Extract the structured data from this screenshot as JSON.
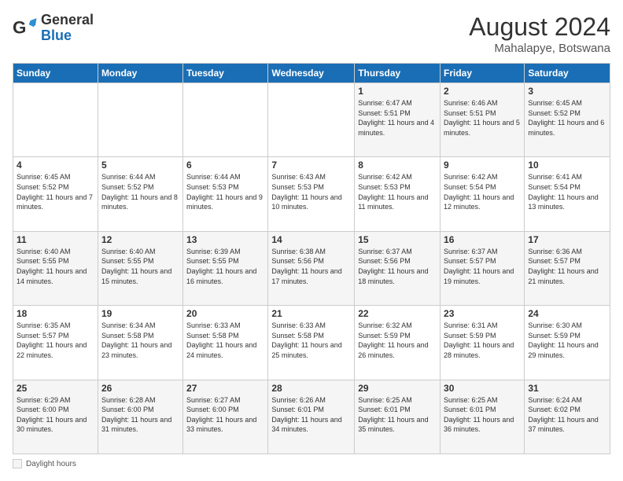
{
  "header": {
    "logo_general": "General",
    "logo_blue": "Blue",
    "month_year": "August 2024",
    "location": "Mahalapye, Botswana"
  },
  "days_of_week": [
    "Sunday",
    "Monday",
    "Tuesday",
    "Wednesday",
    "Thursday",
    "Friday",
    "Saturday"
  ],
  "weeks": [
    [
      {
        "day": "",
        "info": ""
      },
      {
        "day": "",
        "info": ""
      },
      {
        "day": "",
        "info": ""
      },
      {
        "day": "",
        "info": ""
      },
      {
        "day": "1",
        "info": "Sunrise: 6:47 AM\nSunset: 5:51 PM\nDaylight: 11 hours and 4 minutes."
      },
      {
        "day": "2",
        "info": "Sunrise: 6:46 AM\nSunset: 5:51 PM\nDaylight: 11 hours and 5 minutes."
      },
      {
        "day": "3",
        "info": "Sunrise: 6:45 AM\nSunset: 5:52 PM\nDaylight: 11 hours and 6 minutes."
      }
    ],
    [
      {
        "day": "4",
        "info": "Sunrise: 6:45 AM\nSunset: 5:52 PM\nDaylight: 11 hours and 7 minutes."
      },
      {
        "day": "5",
        "info": "Sunrise: 6:44 AM\nSunset: 5:52 PM\nDaylight: 11 hours and 8 minutes."
      },
      {
        "day": "6",
        "info": "Sunrise: 6:44 AM\nSunset: 5:53 PM\nDaylight: 11 hours and 9 minutes."
      },
      {
        "day": "7",
        "info": "Sunrise: 6:43 AM\nSunset: 5:53 PM\nDaylight: 11 hours and 10 minutes."
      },
      {
        "day": "8",
        "info": "Sunrise: 6:42 AM\nSunset: 5:53 PM\nDaylight: 11 hours and 11 minutes."
      },
      {
        "day": "9",
        "info": "Sunrise: 6:42 AM\nSunset: 5:54 PM\nDaylight: 11 hours and 12 minutes."
      },
      {
        "day": "10",
        "info": "Sunrise: 6:41 AM\nSunset: 5:54 PM\nDaylight: 11 hours and 13 minutes."
      }
    ],
    [
      {
        "day": "11",
        "info": "Sunrise: 6:40 AM\nSunset: 5:55 PM\nDaylight: 11 hours and 14 minutes."
      },
      {
        "day": "12",
        "info": "Sunrise: 6:40 AM\nSunset: 5:55 PM\nDaylight: 11 hours and 15 minutes."
      },
      {
        "day": "13",
        "info": "Sunrise: 6:39 AM\nSunset: 5:55 PM\nDaylight: 11 hours and 16 minutes."
      },
      {
        "day": "14",
        "info": "Sunrise: 6:38 AM\nSunset: 5:56 PM\nDaylight: 11 hours and 17 minutes."
      },
      {
        "day": "15",
        "info": "Sunrise: 6:37 AM\nSunset: 5:56 PM\nDaylight: 11 hours and 18 minutes."
      },
      {
        "day": "16",
        "info": "Sunrise: 6:37 AM\nSunset: 5:57 PM\nDaylight: 11 hours and 19 minutes."
      },
      {
        "day": "17",
        "info": "Sunrise: 6:36 AM\nSunset: 5:57 PM\nDaylight: 11 hours and 21 minutes."
      }
    ],
    [
      {
        "day": "18",
        "info": "Sunrise: 6:35 AM\nSunset: 5:57 PM\nDaylight: 11 hours and 22 minutes."
      },
      {
        "day": "19",
        "info": "Sunrise: 6:34 AM\nSunset: 5:58 PM\nDaylight: 11 hours and 23 minutes."
      },
      {
        "day": "20",
        "info": "Sunrise: 6:33 AM\nSunset: 5:58 PM\nDaylight: 11 hours and 24 minutes."
      },
      {
        "day": "21",
        "info": "Sunrise: 6:33 AM\nSunset: 5:58 PM\nDaylight: 11 hours and 25 minutes."
      },
      {
        "day": "22",
        "info": "Sunrise: 6:32 AM\nSunset: 5:59 PM\nDaylight: 11 hours and 26 minutes."
      },
      {
        "day": "23",
        "info": "Sunrise: 6:31 AM\nSunset: 5:59 PM\nDaylight: 11 hours and 28 minutes."
      },
      {
        "day": "24",
        "info": "Sunrise: 6:30 AM\nSunset: 5:59 PM\nDaylight: 11 hours and 29 minutes."
      }
    ],
    [
      {
        "day": "25",
        "info": "Sunrise: 6:29 AM\nSunset: 6:00 PM\nDaylight: 11 hours and 30 minutes."
      },
      {
        "day": "26",
        "info": "Sunrise: 6:28 AM\nSunset: 6:00 PM\nDaylight: 11 hours and 31 minutes."
      },
      {
        "day": "27",
        "info": "Sunrise: 6:27 AM\nSunset: 6:00 PM\nDaylight: 11 hours and 33 minutes."
      },
      {
        "day": "28",
        "info": "Sunrise: 6:26 AM\nSunset: 6:01 PM\nDaylight: 11 hours and 34 minutes."
      },
      {
        "day": "29",
        "info": "Sunrise: 6:25 AM\nSunset: 6:01 PM\nDaylight: 11 hours and 35 minutes."
      },
      {
        "day": "30",
        "info": "Sunrise: 6:25 AM\nSunset: 6:01 PM\nDaylight: 11 hours and 36 minutes."
      },
      {
        "day": "31",
        "info": "Sunrise: 6:24 AM\nSunset: 6:02 PM\nDaylight: 11 hours and 37 minutes."
      }
    ]
  ],
  "footer": {
    "legend_label": "Daylight hours"
  }
}
